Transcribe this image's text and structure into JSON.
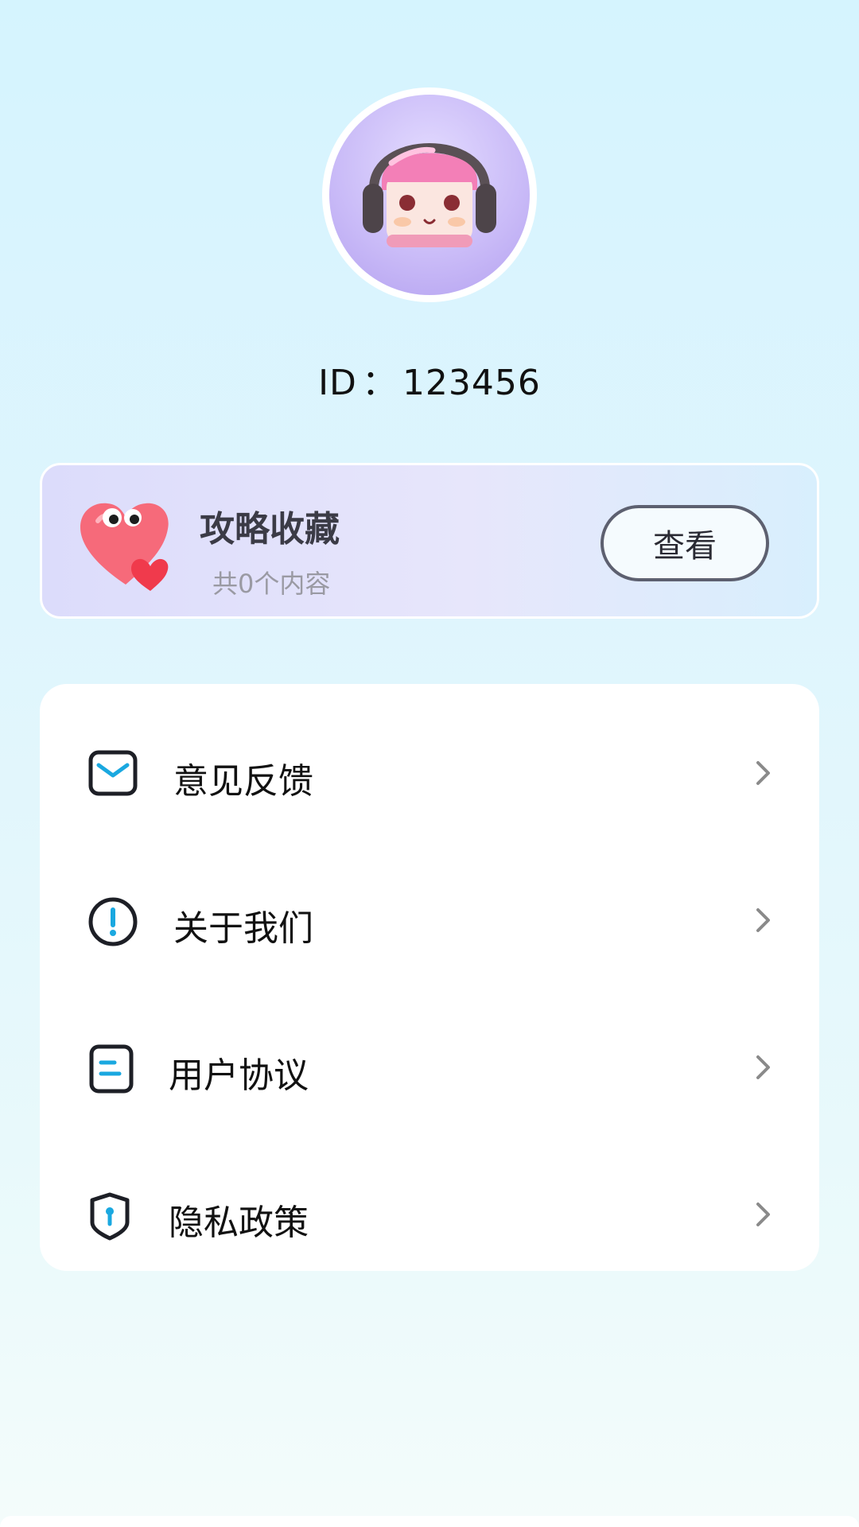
{
  "profile": {
    "id_label": "ID",
    "id_separator": "：",
    "id_value": "123456"
  },
  "favorites": {
    "title": "攻略收藏",
    "subtitle": "共0个内容",
    "button_label": "查看"
  },
  "menu": {
    "items": [
      {
        "label": "意见反馈",
        "icon": "mail-icon"
      },
      {
        "label": "关于我们",
        "icon": "info-icon"
      },
      {
        "label": "用户协议",
        "icon": "document-icon"
      },
      {
        "label": "隐私政策",
        "icon": "shield-icon"
      }
    ]
  },
  "colors": {
    "accent": "#1aa8e0",
    "icon_stroke": "#1d1f26",
    "chevron": "#8a8a8a"
  }
}
